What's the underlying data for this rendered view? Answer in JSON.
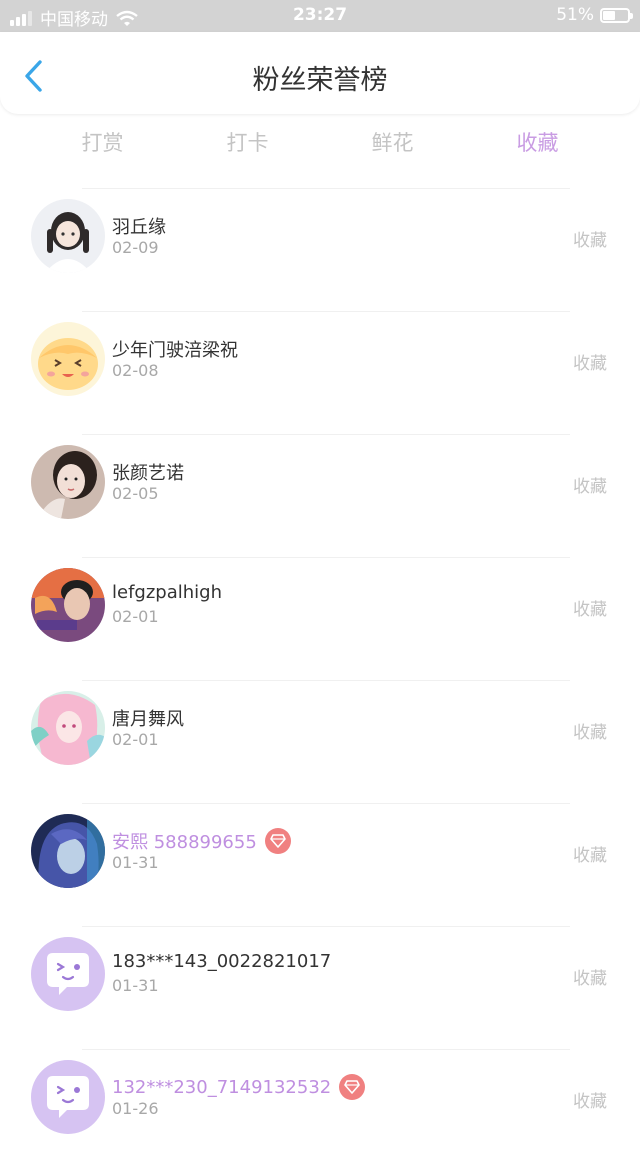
{
  "status_bar": {
    "carrier": "中国移动",
    "time": "23:27",
    "battery": "51%"
  },
  "header": {
    "title": "粉丝荣誉榜"
  },
  "tabs": [
    {
      "label": "打赏",
      "active": false
    },
    {
      "label": "打卡",
      "active": false
    },
    {
      "label": "鲜花",
      "active": false
    },
    {
      "label": "收藏",
      "active": true
    }
  ],
  "fans": [
    {
      "name": "羽丘缘",
      "date": "02-09",
      "action": "收藏",
      "vip": false,
      "avatar": "anime-girl-avatar"
    },
    {
      "name": "少年门驶涪梁祝",
      "date": "02-08",
      "action": "收藏",
      "vip": false,
      "avatar": "cartoon-face-avatar"
    },
    {
      "name": "张颜艺诺",
      "date": "02-05",
      "action": "收藏",
      "vip": false,
      "avatar": "girl-photo-avatar"
    },
    {
      "name": "lefgzpalhigh",
      "date": "02-01",
      "action": "收藏",
      "vip": false,
      "avatar": "boy-photo-avatar"
    },
    {
      "name": "唐月舞风",
      "date": "02-01",
      "action": "收藏",
      "vip": false,
      "avatar": "pink-anime-avatar"
    },
    {
      "name": "安熙 588899655",
      "date": "01-31",
      "action": "收藏",
      "vip": true,
      "avatar": "blue-hair-avatar"
    },
    {
      "name": "183***143_0022821017",
      "date": "01-31",
      "action": "收藏",
      "vip": false,
      "avatar": "default-chat-avatar"
    },
    {
      "name": "132***230_7149132532",
      "date": "01-26",
      "action": "收藏",
      "vip": true,
      "avatar": "default-chat-avatar"
    }
  ],
  "colors": {
    "accent": "#c99ce3",
    "vip_name": "#bf8fe0",
    "vip_badge": "#f08080",
    "inactive": "#c4c4c4",
    "back_arrow": "#3aa6e8"
  }
}
